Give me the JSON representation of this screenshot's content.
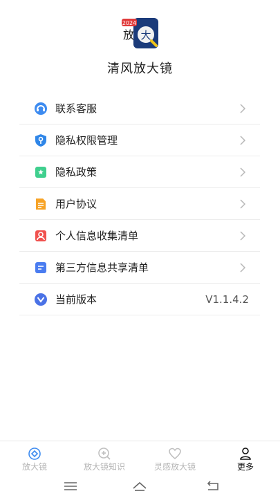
{
  "app": {
    "name": "清风放大镜",
    "logo": {
      "badge_text": "2024",
      "glyph_text": "放",
      "big_text": "大"
    }
  },
  "menu": {
    "items": [
      {
        "label": "联系客服",
        "icon": "headset-icon"
      },
      {
        "label": "隐私权限管理",
        "icon": "shield-key-icon"
      },
      {
        "label": "隐私政策",
        "icon": "bookmark-star-icon"
      },
      {
        "label": "用户协议",
        "icon": "document-icon"
      },
      {
        "label": "个人信息收集清单",
        "icon": "person-card-icon"
      },
      {
        "label": "第三方信息共享清单",
        "icon": "list-card-icon"
      },
      {
        "label": "当前版本",
        "icon": "version-icon",
        "value": "V1.1.4.2"
      }
    ]
  },
  "tabs": [
    {
      "label": "放大镜",
      "icon": "magnifier-diamond-icon",
      "active": false
    },
    {
      "label": "放大镜知识",
      "icon": "magnifier-plus-icon",
      "active": false
    },
    {
      "label": "灵感放大镜",
      "icon": "heart-icon",
      "active": false
    },
    {
      "label": "更多",
      "icon": "person-icon",
      "active": true
    }
  ],
  "colors": {
    "active_tab": "#111111",
    "inactive_tab": "#b5b5b5",
    "divider": "#ececec"
  }
}
